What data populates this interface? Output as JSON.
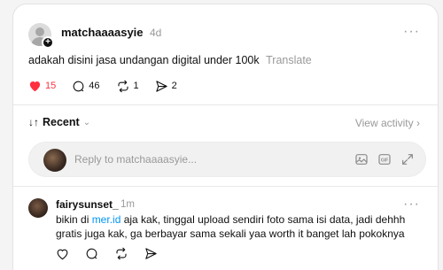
{
  "post": {
    "username": "matchaaaasyie",
    "time": "4d",
    "more_label": "···",
    "text": "adakah disini jasa undangan digital under 100k",
    "translate": "Translate",
    "likes": "15",
    "comments": "46",
    "reposts": "1",
    "shares": "2",
    "like_color": "#ff3040"
  },
  "sort": {
    "label": "Recent",
    "arrows": "↓↑",
    "view_activity": "View activity",
    "chevron": "›"
  },
  "reply": {
    "placeholder": "Reply to matchaaaasyie..."
  },
  "comment": {
    "username": "fairysunset_",
    "time": "1m",
    "more_label": "···",
    "text_before": "bikin di ",
    "link": "mer.id",
    "text_after": " aja kak, tinggal upload sendiri foto sama isi data, jadi dehhh gratis juga kak, ga berbayar sama sekali yaa worth it banget lah pokoknya"
  },
  "icons": {
    "like": "heart-icon",
    "comment": "comment-bubble-icon",
    "repost": "repost-icon",
    "share": "share-send-icon",
    "image": "image-icon",
    "gif": "gif-icon",
    "expand": "expand-icon"
  }
}
